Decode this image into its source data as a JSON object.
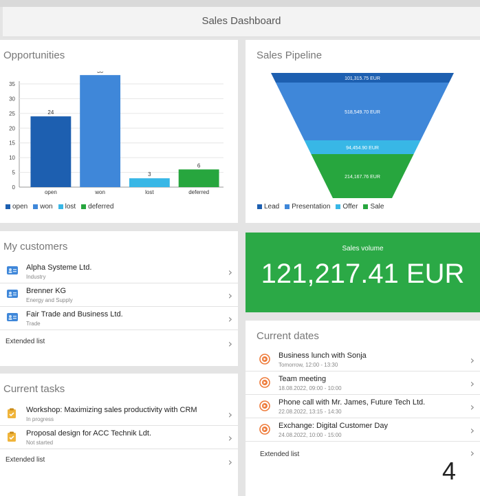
{
  "header": {
    "title": "Sales Dashboard"
  },
  "opportunities": {
    "title": "Opportunities",
    "legend": [
      {
        "label": "open",
        "color": "#1d5fb0"
      },
      {
        "label": "won",
        "color": "#3f87d9"
      },
      {
        "label": "lost",
        "color": "#38b7e6"
      },
      {
        "label": "deferred",
        "color": "#27a63e"
      }
    ]
  },
  "chart_data": [
    {
      "type": "bar",
      "title": "Opportunities",
      "categories": [
        "open",
        "won",
        "lost",
        "deferred"
      ],
      "values": [
        24,
        38,
        3,
        6
      ],
      "colors": [
        "#1d5fb0",
        "#3f87d9",
        "#38b7e6",
        "#27a63e"
      ],
      "ylim": [
        0,
        35
      ],
      "yticks": [
        0,
        5,
        10,
        15,
        20,
        25,
        30,
        35
      ],
      "grid": true,
      "legend": "bottom"
    },
    {
      "type": "funnel",
      "title": "Sales Pipeline",
      "categories": [
        "Lead",
        "Presentation",
        "Offer",
        "Sale"
      ],
      "labels": [
        "101,315.75 EUR",
        "518,549.70 EUR",
        "94,454.90 EUR",
        "214,167.76 EUR"
      ],
      "values": [
        101315.75,
        518549.7,
        94454.9,
        214167.76
      ],
      "colors": [
        "#1d5fb0",
        "#3f87d9",
        "#38b7e6",
        "#27a63e"
      ],
      "legend": "bottom"
    }
  ],
  "pipeline": {
    "title": "Sales Pipeline",
    "legend": [
      {
        "label": "Lead",
        "color": "#1d5fb0"
      },
      {
        "label": "Presentation",
        "color": "#3f87d9"
      },
      {
        "label": "Offer",
        "color": "#38b7e6"
      },
      {
        "label": "Sale",
        "color": "#27a63e"
      }
    ]
  },
  "sales_volume": {
    "label": "Sales volume",
    "value": "121,217.41 EUR",
    "color": "#2ba946"
  },
  "customers": {
    "title": "My customers",
    "items": [
      {
        "name": "Alpha Systeme Ltd.",
        "sub": "Industry"
      },
      {
        "name": "Brenner KG",
        "sub": "Energy and Supply"
      },
      {
        "name": "Fair Trade and Business Ltd.",
        "sub": "Trade"
      }
    ],
    "extended": "Extended list"
  },
  "tasks": {
    "title": "Current tasks",
    "items": [
      {
        "name": "Workshop: Maximizing sales productivity with CRM",
        "sub": "In progress"
      },
      {
        "name": "Proposal design for ACC Technik Ldt.",
        "sub": "Not started"
      }
    ],
    "extended": "Extended list"
  },
  "dates": {
    "title": "Current dates",
    "items": [
      {
        "name": "Business lunch with Sonja",
        "sub": "Tomorrow, 12:00 - 13:30"
      },
      {
        "name": "Team meeting",
        "sub": "18.08.2022, 09:00 - 10:00"
      },
      {
        "name": "Phone call with Mr. James, Future Tech Ltd.",
        "sub": "22.08.2022, 13:15 - 14:30"
      },
      {
        "name": "Exchange: Digital Customer Day",
        "sub": "24.08.2022, 10:00 - 15:00"
      }
    ],
    "extended": "Extended list"
  },
  "page_number": "4"
}
